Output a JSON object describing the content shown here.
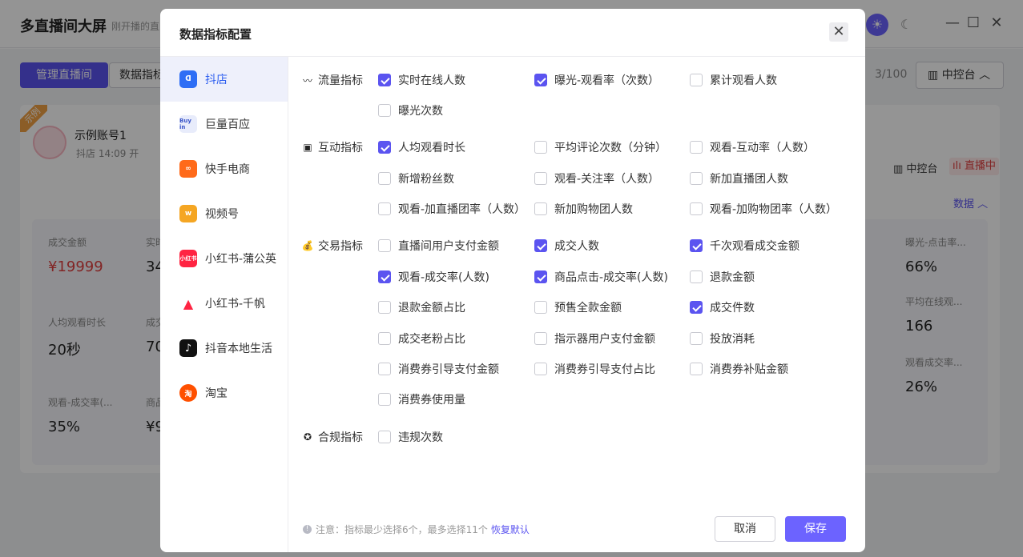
{
  "app": {
    "title": "多直播间大屏",
    "subtitle": "刚开播的直",
    "manage_button": "管理直播间",
    "data_metrics_button": "数据指标",
    "count": "3/100",
    "control_button": "中控台"
  },
  "card": {
    "demo_badge": "示例",
    "account_name": "示例账号1",
    "account_meta": "抖店   14:09 开",
    "control_label": "中控台",
    "live_label": "直播中",
    "data_toggle": "数据",
    "metrics": [
      {
        "label": "成交金额",
        "value": "¥19999"
      },
      {
        "label": "实时",
        "value": "34"
      },
      {
        "label": "曝光-点击率...",
        "value": "66%"
      },
      {
        "label": "人均观看时长",
        "value": "20秒"
      },
      {
        "label": "成交",
        "value": "70"
      },
      {
        "label": "平均在线观...",
        "value": "166"
      },
      {
        "label": "观看-成交率(...",
        "value": "35%"
      },
      {
        "label": "商品",
        "value": "¥9"
      },
      {
        "label": "观看成交率...",
        "value": "26%"
      }
    ]
  },
  "modal": {
    "title": "数据指标配置",
    "platforms": [
      {
        "label": "抖店",
        "icon": "douyin-shop-icon",
        "color": "#2e6ef5"
      },
      {
        "label": "巨量百应",
        "icon": "buyin-icon",
        "color": "#e8ecfb"
      },
      {
        "label": "快手电商",
        "icon": "kuaishou-icon",
        "color": "#ff6a1a"
      },
      {
        "label": "视频号",
        "icon": "channels-icon",
        "color": "#f5a623"
      },
      {
        "label": "小红书-蒲公英",
        "icon": "xiaohongshu-icon",
        "color": "#ff2442"
      },
      {
        "label": "小红书-千帆",
        "icon": "qianfan-icon",
        "color": "#ff2442"
      },
      {
        "label": "抖音本地生活",
        "icon": "tiktok-local-icon",
        "color": "#111111"
      },
      {
        "label": "淘宝",
        "icon": "taobao-icon",
        "color": "#ff5000"
      }
    ],
    "groups": [
      {
        "label": "流量指标",
        "icon": "traffic-icon",
        "options": [
          {
            "label": "实时在线人数",
            "checked": true
          },
          {
            "label": "曝光-观看率（次数）",
            "checked": true
          },
          {
            "label": "累计观看人数",
            "checked": false
          },
          {
            "label": "曝光次数",
            "checked": false
          }
        ]
      },
      {
        "label": "互动指标",
        "icon": "interaction-icon",
        "options": [
          {
            "label": "人均观看时长",
            "checked": true
          },
          {
            "label": "平均评论次数（分钟）",
            "checked": false
          },
          {
            "label": "观看-互动率（人数）",
            "checked": false
          },
          {
            "label": "新增粉丝数",
            "checked": false
          },
          {
            "label": "观看-关注率（人数）",
            "checked": false
          },
          {
            "label": "新加直播团人数",
            "checked": false
          },
          {
            "label": "观看-加直播团率（人数）",
            "checked": false
          },
          {
            "label": "新加购物团人数",
            "checked": false
          },
          {
            "label": "观看-加购物团率（人数）",
            "checked": false
          }
        ]
      },
      {
        "label": "交易指标",
        "icon": "money-bag-icon",
        "options": [
          {
            "label": "直播间用户支付金额",
            "checked": false
          },
          {
            "label": "成交人数",
            "checked": true
          },
          {
            "label": "千次观看成交金额",
            "checked": true
          },
          {
            "label": "观看-成交率(人数)",
            "checked": true
          },
          {
            "label": "商品点击-成交率(人数)",
            "checked": true
          },
          {
            "label": "退款金额",
            "checked": false
          },
          {
            "label": "退款金额占比",
            "checked": false
          },
          {
            "label": "预售全款金额",
            "checked": false
          },
          {
            "label": "成交件数",
            "checked": true
          },
          {
            "label": "成交老粉占比",
            "checked": false
          },
          {
            "label": "指示器用户支付金额",
            "checked": false
          },
          {
            "label": "投放消耗",
            "checked": false
          },
          {
            "label": "消费券引导支付金额",
            "checked": false
          },
          {
            "label": "消费券引导支付占比",
            "checked": false
          },
          {
            "label": "消费券补贴金额",
            "checked": false
          },
          {
            "label": "消费券使用量",
            "checked": false
          }
        ]
      },
      {
        "label": "合规指标",
        "icon": "compliance-icon",
        "options": [
          {
            "label": "违规次数",
            "checked": false
          }
        ]
      }
    ],
    "note": "注意：指标最少选择6个，最多选择11个",
    "restore_default": "恢复默认",
    "cancel": "取消",
    "save": "保存"
  }
}
